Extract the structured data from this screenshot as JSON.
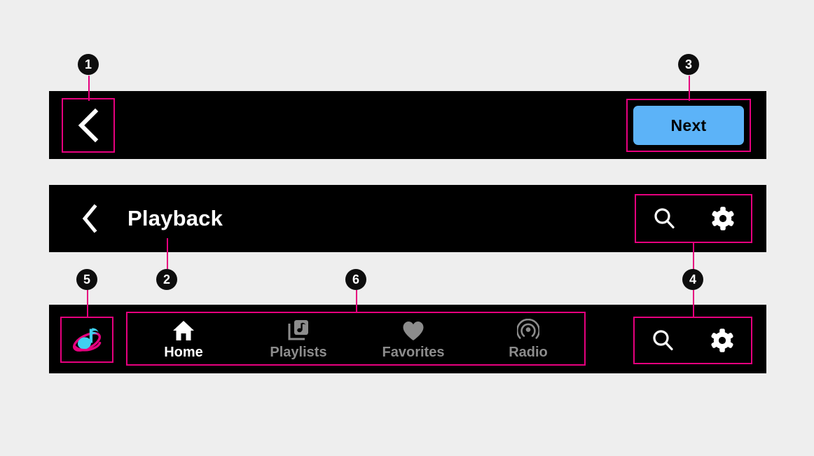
{
  "theme": {
    "background": "#eeeeee",
    "bar_background": "#000000",
    "annotation_color": "#e6007e",
    "accent_button": "#5cb3f8",
    "active_label": "#ffffff",
    "inactive_label": "#8c8c8c",
    "logo_note_color": "#3fd0f0",
    "logo_ring_color": "#e6007e"
  },
  "top_bar": {
    "back_button": {
      "icon": "chevron-left-icon",
      "label": ""
    },
    "next_button": {
      "label": "Next"
    }
  },
  "header_bar": {
    "back_button": {
      "icon": "chevron-left-icon"
    },
    "title": "Playback",
    "actions": [
      {
        "icon": "search-icon",
        "label": "Search"
      },
      {
        "icon": "gear-icon",
        "label": "Settings"
      }
    ]
  },
  "tab_bar": {
    "brand_logo": {
      "icon": "music-note-orbit-logo"
    },
    "tabs": [
      {
        "label": "Home",
        "icon": "home-icon",
        "active": true
      },
      {
        "label": "Playlists",
        "icon": "playlists-library-icon",
        "active": false
      },
      {
        "label": "Favorites",
        "icon": "heart-icon",
        "active": false
      },
      {
        "label": "Radio",
        "icon": "radio-broadcast-icon",
        "active": false
      }
    ],
    "actions": [
      {
        "icon": "search-icon",
        "label": "Search"
      },
      {
        "icon": "gear-icon",
        "label": "Settings"
      }
    ]
  },
  "annotations": [
    {
      "number": "1",
      "target": "top-bar-back-button"
    },
    {
      "number": "2",
      "target": "header-title"
    },
    {
      "number": "3",
      "target": "next-button"
    },
    {
      "number": "4",
      "target": "action-icons-group"
    },
    {
      "number": "5",
      "target": "brand-logo"
    },
    {
      "number": "6",
      "target": "tabs-group"
    }
  ]
}
